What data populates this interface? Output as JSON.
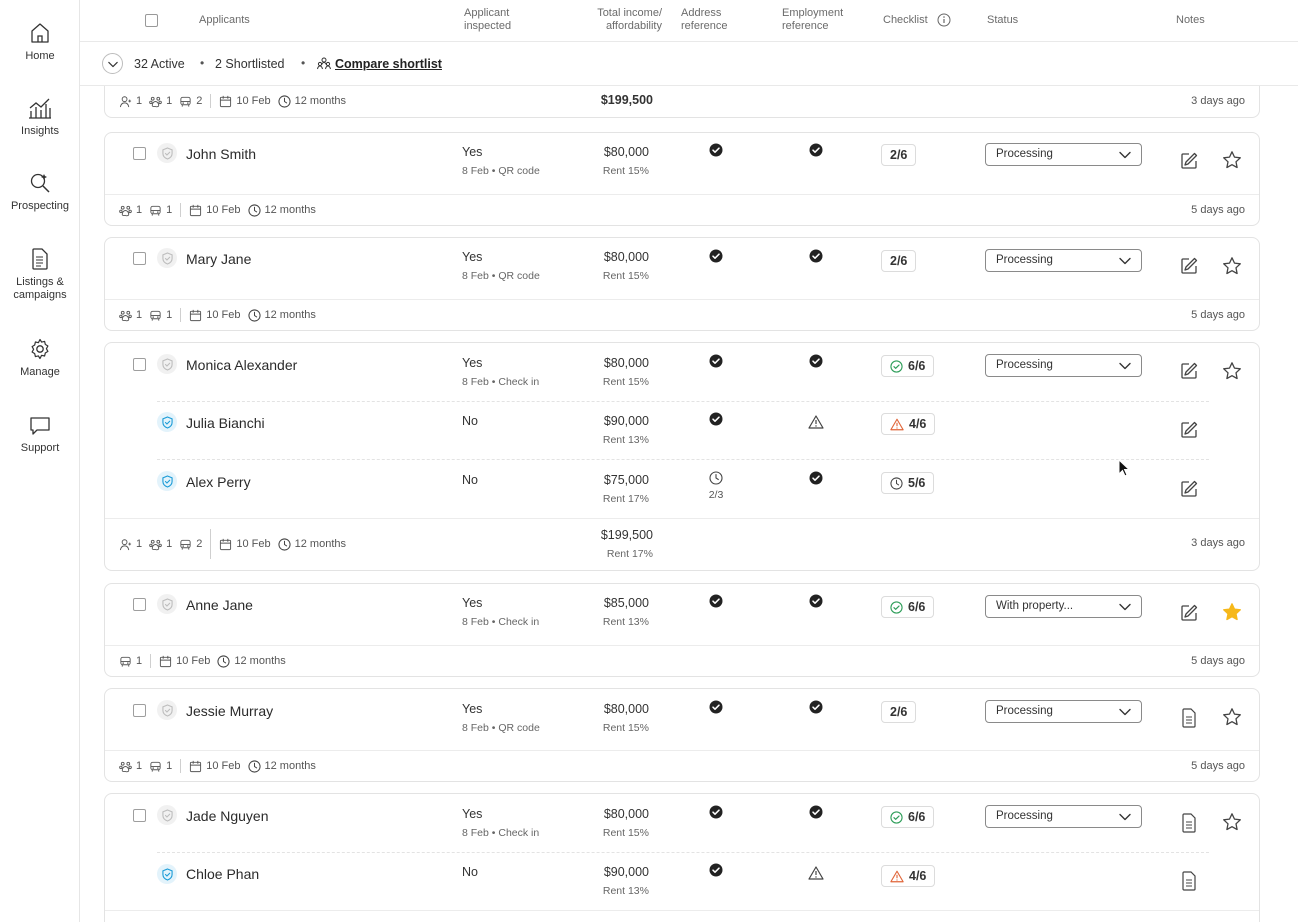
{
  "sidebar": {
    "items": [
      {
        "label": "Home",
        "icon": "home-icon"
      },
      {
        "label": "Insights",
        "icon": "chart-icon"
      },
      {
        "label": "Prospecting",
        "icon": "magnify-sparkle-icon"
      },
      {
        "label": "Listings & campaigns",
        "icon": "document-icon"
      },
      {
        "label": "Manage",
        "icon": "gear-icon"
      },
      {
        "label": "Support",
        "icon": "chat-icon"
      }
    ]
  },
  "header": {
    "applicants": "Applicants",
    "inspected": "Applicant inspected",
    "income": "Total income/ affordability",
    "address": "Address reference",
    "employment": "Employment reference",
    "checklist": "Checklist",
    "status": "Status",
    "notes": "Notes"
  },
  "summary": {
    "active": "32 Active",
    "shortlisted": "2 Shortlisted",
    "compare": "Compare shortlist",
    "dot": "•"
  },
  "top_footer": {
    "people": "1",
    "pets": "1",
    "cars": "2",
    "date": "10 Feb",
    "lease": "12 months",
    "total": "$199,500",
    "ago": "3 days ago"
  },
  "cards": [
    {
      "rows": [
        {
          "name": "John Smith",
          "inspected": "Yes",
          "inspected_sub": "8 Feb • QR code",
          "income": "$80,000",
          "rent": "Rent 15%",
          "checklist": "2/6",
          "status": "Processing"
        }
      ],
      "footer": {
        "pets": "1",
        "cars": "1",
        "date": "10 Feb",
        "lease": "12 months",
        "ago": "5 days ago"
      }
    },
    {
      "rows": [
        {
          "name": "Mary Jane",
          "inspected": "Yes",
          "inspected_sub": "8 Feb • QR code",
          "income": "$80,000",
          "rent": "Rent 15%",
          "checklist": "2/6",
          "status": "Processing"
        }
      ],
      "footer": {
        "pets": "1",
        "cars": "1",
        "date": "10 Feb",
        "lease": "12 months",
        "ago": "5 days ago"
      }
    },
    {
      "rows": [
        {
          "name": "Monica Alexander",
          "inspected": "Yes",
          "inspected_sub": "8 Feb • Check in",
          "income": "$80,000",
          "rent": "Rent 15%",
          "checklist": "6/6",
          "status": "Processing"
        },
        {
          "name": "Julia Bianchi",
          "inspected": "No",
          "income": "$90,000",
          "rent": "Rent 13%",
          "checklist": "4/6"
        },
        {
          "name": "Alex Perry",
          "inspected": "No",
          "income": "$75,000",
          "rent": "Rent 17%",
          "address_sub": "2/3",
          "checklist": "5/6"
        }
      ],
      "footer": {
        "people": "1",
        "pets": "1",
        "cars": "2",
        "date": "10 Feb",
        "lease": "12 months",
        "total": "$199,500",
        "rent": "Rent 17%",
        "ago": "3 days ago"
      }
    },
    {
      "rows": [
        {
          "name": "Anne Jane",
          "inspected": "Yes",
          "inspected_sub": "8 Feb • Check in",
          "income": "$85,000",
          "rent": "Rent 13%",
          "checklist": "6/6",
          "status": "With property..."
        }
      ],
      "footer": {
        "cars": "1",
        "date": "10 Feb",
        "lease": "12 months",
        "ago": "5 days ago"
      }
    },
    {
      "rows": [
        {
          "name": "Jessie Murray",
          "inspected": "Yes",
          "inspected_sub": "8 Feb • QR code",
          "income": "$80,000",
          "rent": "Rent 15%",
          "checklist": "2/6",
          "status": "Processing"
        }
      ],
      "footer": {
        "pets": "1",
        "cars": "1",
        "date": "10 Feb",
        "lease": "12 months",
        "ago": "5 days ago"
      }
    },
    {
      "rows": [
        {
          "name": "Jade Nguyen",
          "inspected": "Yes",
          "inspected_sub": "8 Feb • Check in",
          "income": "$80,000",
          "rent": "Rent 15%",
          "checklist": "6/6",
          "status": "Processing"
        },
        {
          "name": "Chloe Phan",
          "inspected": "No",
          "income": "$90,000",
          "rent": "Rent 13%",
          "checklist": "4/6"
        }
      ]
    }
  ],
  "colors": {
    "star_active": "#f6b81a",
    "warning": "#e0663a",
    "success": "#2f9e5a",
    "shield_blue": "#1a9bd7"
  }
}
